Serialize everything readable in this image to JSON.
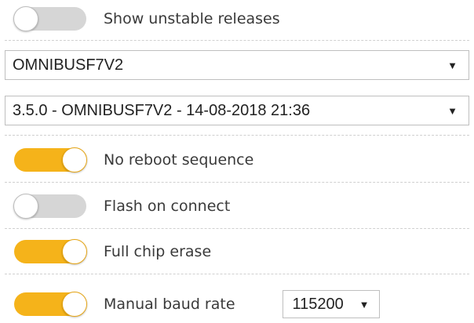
{
  "toggles": {
    "unstable": {
      "label": "Show unstable releases",
      "state": "off"
    },
    "no_reboot": {
      "label": "No reboot sequence",
      "state": "on"
    },
    "flash_on_connect": {
      "label": "Flash on connect",
      "state": "off"
    },
    "full_chip_erase": {
      "label": "Full chip erase",
      "state": "on"
    },
    "manual_baud": {
      "label": "Manual baud rate",
      "state": "on"
    }
  },
  "board_select": {
    "value": "OMNIBUSF7V2",
    "arrow": "▼"
  },
  "firmware_select": {
    "value": "3.5.0 - OMNIBUSF7V2 - 14-08-2018 21:36",
    "arrow": "▼"
  },
  "baud_select": {
    "value": "115200",
    "arrow": "▼"
  },
  "colors": {
    "accent": "#f5b31a",
    "toggle_off": "#d6d6d6"
  }
}
